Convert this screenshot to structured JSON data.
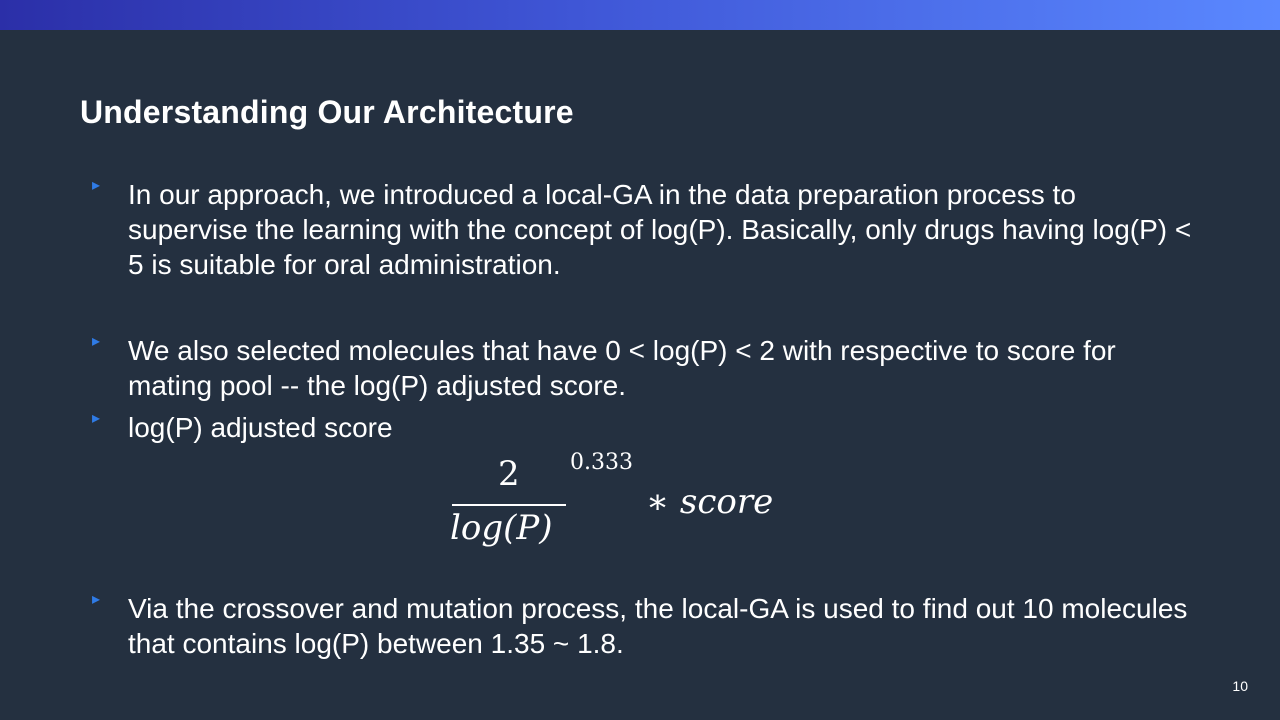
{
  "slide": {
    "title": "Understanding Our Architecture",
    "page_number": "10"
  },
  "bullets": [
    {
      "marker": "▸",
      "text": "In our approach, we introduced a local-GA in the data preparation process to supervise the learning with the concept of log(P).  Basically, only drugs having log(P) < 5 is suitable for oral administration."
    },
    {
      "marker": "▸",
      "text": "We also selected molecules that have 0 < log(P) < 2 with respective to score for mating pool -- the log(P) adjusted score."
    },
    {
      "marker": "▸",
      "text": "log(P) adjusted score"
    },
    {
      "marker": "▸",
      "text": "Via the crossover and mutation process, the local-GA is used to find out 10 molecules that contains log(P) between 1.35 ~ 1.8."
    }
  ],
  "formula": {
    "numerator": "2",
    "denominator": "log(P)",
    "exponent": "0.333",
    "multiplier": "∗ score"
  },
  "colors": {
    "background": "#243040",
    "bullet_marker": "#2f7be6",
    "top_bar_start": "#2b2fa8",
    "top_bar_end": "#5a88ff"
  }
}
